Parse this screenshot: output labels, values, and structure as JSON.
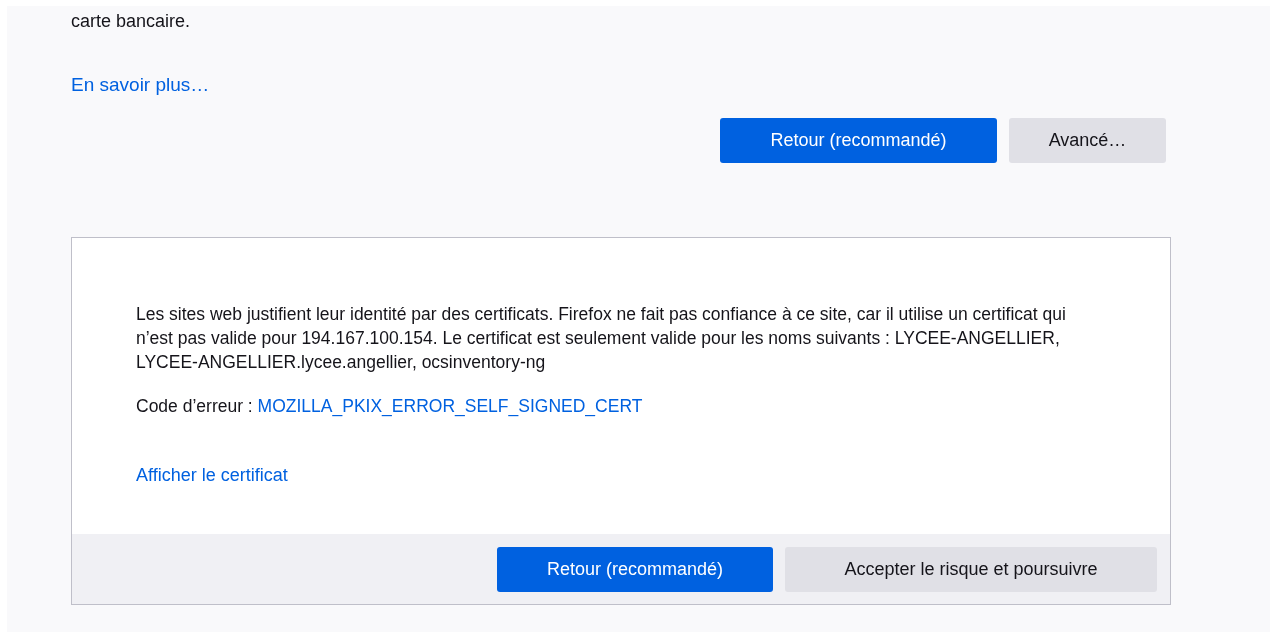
{
  "intro_tail": "carte bancaire.",
  "learn_more_link": "En savoir plus…",
  "buttons": [
    {
      "label": "Retour (recommandé)",
      "kind": "primary"
    },
    {
      "label": "Avancé…",
      "kind": "secondary"
    }
  ],
  "advanced_panel": {
    "description": "Les sites web justifient leur identité par des certificats. Firefox ne fait pas confiance à ce site, car il utilise un certificat qui n’est pas valide pour 194.167.100.154. Le certificat est seulement valide pour les noms suivants : LYCEE-ANGELLIER, LYCEE-ANGELLIER.lycee.angellier, ocsinventory-ng",
    "error_code_label": "Code d’erreur :",
    "error_code": "MOZILLA_PKIX_ERROR_SELF_SIGNED_CERT",
    "view_certificate_link": "Afficher le certificat",
    "buttons": [
      {
        "label": "Retour (recommandé)",
        "kind": "primary"
      },
      {
        "label": "Accepter le risque et poursuivre",
        "kind": "secondary"
      }
    ]
  }
}
